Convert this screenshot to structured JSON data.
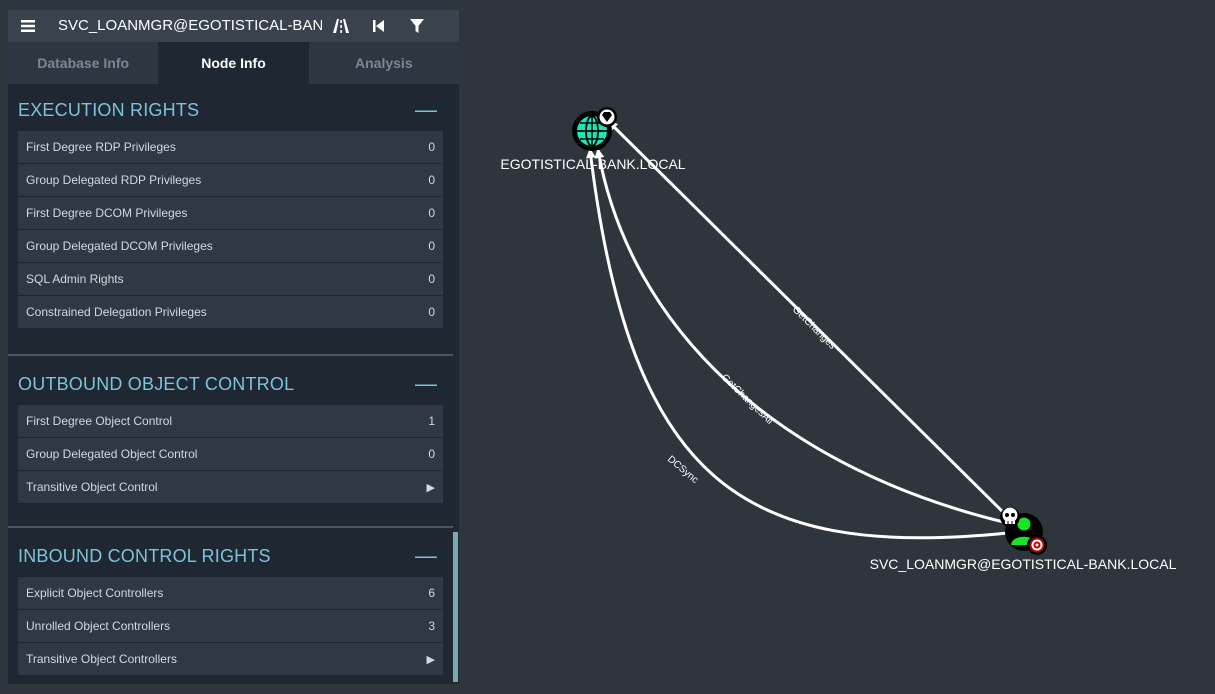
{
  "header": {
    "search_value": "SVC_LOANMGR@EGOTISTICAL-BANK.LOCAL"
  },
  "tabs": [
    {
      "label": "Database Info",
      "active": false
    },
    {
      "label": "Node Info",
      "active": true
    },
    {
      "label": "Analysis",
      "active": false
    }
  ],
  "sections": {
    "execution": {
      "title": "EXECUTION RIGHTS",
      "rows": [
        {
          "label": "First Degree RDP Privileges",
          "value": "0"
        },
        {
          "label": "Group Delegated RDP Privileges",
          "value": "0"
        },
        {
          "label": "First Degree DCOM Privileges",
          "value": "0"
        },
        {
          "label": "Group Delegated DCOM Privileges",
          "value": "0"
        },
        {
          "label": "SQL Admin Rights",
          "value": "0"
        },
        {
          "label": "Constrained Delegation Privileges",
          "value": "0"
        }
      ]
    },
    "outbound": {
      "title": "OUTBOUND OBJECT CONTROL",
      "rows": [
        {
          "label": "First Degree Object Control",
          "value": "1"
        },
        {
          "label": "Group Delegated Object Control",
          "value": "0"
        },
        {
          "label": "Transitive Object Control",
          "value": "▶"
        }
      ]
    },
    "inbound": {
      "title": "INBOUND CONTROL RIGHTS",
      "rows": [
        {
          "label": "Explicit Object Controllers",
          "value": "6"
        },
        {
          "label": "Unrolled Object Controllers",
          "value": "3"
        },
        {
          "label": "Transitive Object Controllers",
          "value": "▶"
        }
      ]
    }
  },
  "graph": {
    "domain_node_label": "EGOTISTICAL-BANK.LOCAL",
    "user_node_label": "SVC_LOANMGR@EGOTISTICAL-BANK.LOCAL",
    "edges": [
      "GetChanges",
      "GetChangesAll",
      "DCSync"
    ],
    "colors": {
      "domain": "#17e6b7",
      "user": "#17e625",
      "edge": "#ffffff",
      "target": "#c20000"
    }
  }
}
